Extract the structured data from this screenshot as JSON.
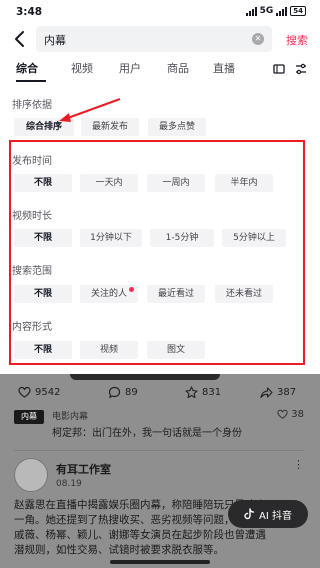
{
  "status_bar": {
    "time": "3:48",
    "signal_text": "5G",
    "battery": "54"
  },
  "search": {
    "query": "内幕",
    "search_label": "搜索"
  },
  "tabs": [
    {
      "label": "综合"
    },
    {
      "label": "视频"
    },
    {
      "label": "用户"
    },
    {
      "label": "商品"
    },
    {
      "label": "直播"
    }
  ],
  "sort": {
    "label": "排序依据",
    "options": [
      "综合排序",
      "最新发布",
      "最多点赞"
    ],
    "selected": "综合排序"
  },
  "publish_time": {
    "label": "发布时间",
    "options": [
      "不限",
      "一天内",
      "一周内",
      "半年内"
    ],
    "selected": "不限"
  },
  "video_duration": {
    "label": "视频时长",
    "options": [
      "不限",
      "1分钟以下",
      "1-5分钟",
      "5分钟以上"
    ],
    "selected": "不限"
  },
  "search_scope": {
    "label": "搜索范围",
    "options": [
      "不限",
      "关注的人",
      "最近看过",
      "还未看过"
    ],
    "selected": "不限"
  },
  "content_form": {
    "label": "内容形式",
    "options": [
      "不限",
      "视频",
      "图文"
    ],
    "selected": "不限"
  },
  "feed": {
    "stats": {
      "likes": "9542",
      "comments": "89",
      "favorites": "831",
      "shares": "387"
    },
    "comment": {
      "logo_text": "内幕",
      "source": "电影内幕",
      "text": "柯定邦：出门在外，我一句话就是一个身份",
      "likes": "38"
    },
    "post": {
      "author": "有耳工作室",
      "date": "08.19",
      "lines": [
        "赵露思在直播中揭露娱乐圈内幕，称陪睡陪玩只是冰山",
        "一角。她还提到了热搜收买、恶劣视频等问题，并点名",
        "戚薇、杨幂、颖儿、谢娜等女演员在起步阶段也曾遭遇",
        "潜规则，如性交易、试镜时被要求脱衣服等。"
      ]
    },
    "ai_button_label": "AI 抖音"
  },
  "colors": {
    "accent": "#fe2c55",
    "highlight_box": "#ec1c24"
  }
}
